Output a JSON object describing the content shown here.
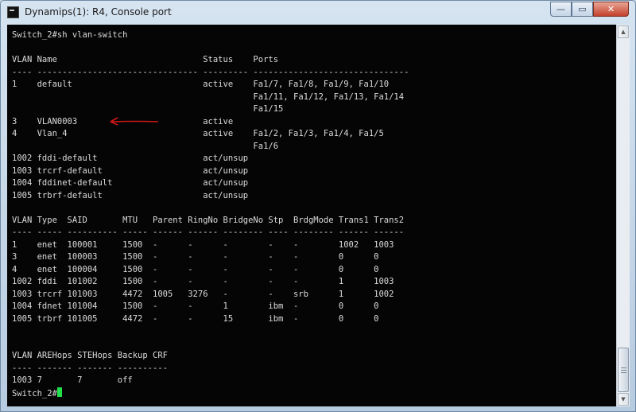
{
  "window": {
    "title": "Dynamips(1): R4, Console port",
    "controls": {
      "minimize": "—",
      "maximize": "▭",
      "close": "✕"
    }
  },
  "console": {
    "prompt_line": "Switch_2#",
    "lines": [
      "Switch_2#sh vlan-switch",
      "",
      "VLAN Name                             Status    Ports",
      "---- -------------------------------- --------- -------------------------------",
      "1    default                          active    Fa1/7, Fa1/8, Fa1/9, Fa1/10",
      "                                                Fa1/11, Fa1/12, Fa1/13, Fa1/14",
      "                                                Fa1/15",
      "3    VLAN0003                         active",
      "4    Vlan_4                           active    Fa1/2, Fa1/3, Fa1/4, Fa1/5",
      "                                                Fa1/6",
      "1002 fddi-default                     act/unsup",
      "1003 trcrf-default                    act/unsup",
      "1004 fddinet-default                  act/unsup",
      "1005 trbrf-default                    act/unsup",
      "",
      "VLAN Type  SAID       MTU   Parent RingNo BridgeNo Stp  BrdgMode Trans1 Trans2",
      "---- ----- ---------- ----- ------ ------ -------- ---- -------- ------ ------",
      "1    enet  100001     1500  -      -      -        -    -        1002   1003",
      "3    enet  100003     1500  -      -      -        -    -        0      0",
      "4    enet  100004     1500  -      -      -        -    -        0      0",
      "1002 fddi  101002     1500  -      -      -        -    -        1      1003",
      "1003 trcrf 101003     4472  1005   3276   -        -    srb      1      1002",
      "1004 fdnet 101004     1500  -      -      1        ibm  -        0      0",
      "1005 trbrf 101005     4472  -      -      15       ibm  -        0      0",
      "",
      "",
      "VLAN AREHops STEHops Backup CRF",
      "---- ------- ------- ----------",
      "1003 7       7       off"
    ]
  },
  "colors": {
    "console_bg": "#050505",
    "console_text": "#dcdcdc",
    "cursor": "#22e04a",
    "annotation_arrow": "#d01818"
  }
}
